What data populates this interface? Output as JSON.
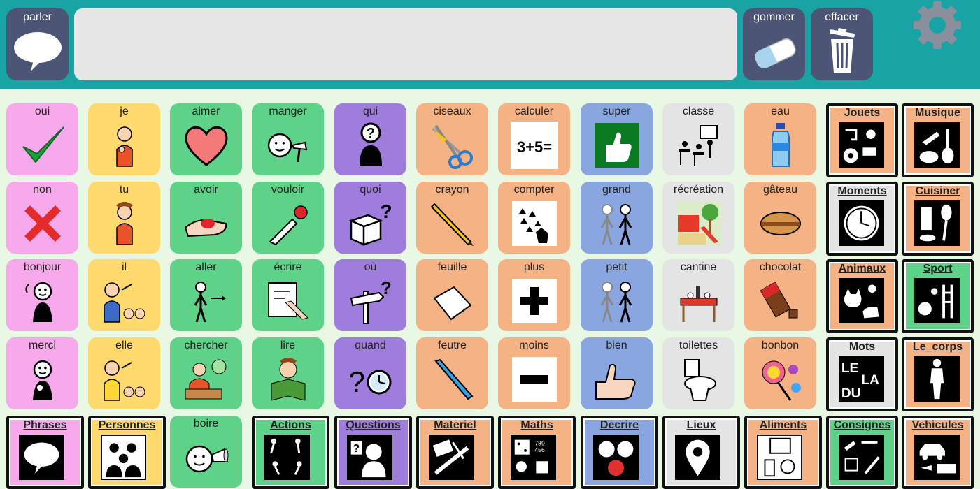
{
  "toolbar": {
    "speak_label": "parler",
    "erase_label": "gommer",
    "clear_label": "effacer",
    "message_text": ""
  },
  "colors": {
    "topbar": "#19a3a5",
    "button": "#4d5576",
    "background": "#e8f8e4",
    "pink": "#f7a9ec",
    "yellow": "#fdd96e",
    "green": "#5fd28a",
    "purple": "#9f7ddd",
    "orange": "#f5b284",
    "blue": "#8aa6e0",
    "gray": "#e4e4e4"
  },
  "grid": {
    "rows": [
      [
        {
          "label": "oui",
          "icon": "checkmark-icon",
          "color": "pink"
        },
        {
          "label": "je",
          "icon": "person-self-icon",
          "color": "yellow"
        },
        {
          "label": "aimer",
          "icon": "heart-icon",
          "color": "green"
        },
        {
          "label": "manger",
          "icon": "eating-icon",
          "color": "green"
        },
        {
          "label": "qui",
          "icon": "who-question-icon",
          "color": "purple"
        },
        {
          "label": "ciseaux",
          "icon": "scissors-icon",
          "color": "orange"
        },
        {
          "label": "calculer",
          "icon": "calculation-icon",
          "color": "orange",
          "pic_text": "3+5="
        },
        {
          "label": "super",
          "icon": "thumbs-up-green-icon",
          "color": "blue"
        },
        {
          "label": "classe",
          "icon": "classroom-icon",
          "color": "gray"
        },
        {
          "label": "eau",
          "icon": "water-bottle-icon",
          "color": "orange"
        },
        {
          "label": "Jouets",
          "icon": "toys-icon",
          "color": "orange",
          "folder": true
        },
        {
          "label": "Musique",
          "icon": "music-instruments-icon",
          "color": "orange",
          "folder": true
        }
      ],
      [
        {
          "label": "non",
          "icon": "cross-icon",
          "color": "pink"
        },
        {
          "label": "tu",
          "icon": "person-you-icon",
          "color": "yellow"
        },
        {
          "label": "avoir",
          "icon": "hand-holding-icon",
          "color": "green"
        },
        {
          "label": "vouloir",
          "icon": "hand-reaching-icon",
          "color": "green"
        },
        {
          "label": "quoi",
          "icon": "box-question-icon",
          "color": "purple"
        },
        {
          "label": "crayon",
          "icon": "pencil-icon",
          "color": "orange"
        },
        {
          "label": "compter",
          "icon": "counting-icon",
          "color": "orange"
        },
        {
          "label": "grand",
          "icon": "tall-person-icon",
          "color": "blue"
        },
        {
          "label": "récréation",
          "icon": "playground-icon",
          "color": "gray"
        },
        {
          "label": "gâteau",
          "icon": "cake-icon",
          "color": "orange"
        },
        {
          "label": "Moments",
          "icon": "clock-icon",
          "color": "gray",
          "folder": true
        },
        {
          "label": "Cuisiner",
          "icon": "kitchen-utensils-icon",
          "color": "orange",
          "folder": true
        }
      ],
      [
        {
          "label": "bonjour",
          "icon": "waving-person-icon",
          "color": "pink"
        },
        {
          "label": "il",
          "icon": "him-icon",
          "color": "yellow"
        },
        {
          "label": "aller",
          "icon": "walking-icon",
          "color": "green"
        },
        {
          "label": "écrire",
          "icon": "writing-icon",
          "color": "green"
        },
        {
          "label": "où",
          "icon": "signpost-question-icon",
          "color": "purple"
        },
        {
          "label": "feuille",
          "icon": "paper-sheet-icon",
          "color": "orange"
        },
        {
          "label": "plus",
          "icon": "plus-icon",
          "color": "orange"
        },
        {
          "label": "petit",
          "icon": "short-person-icon",
          "color": "blue"
        },
        {
          "label": "cantine",
          "icon": "dining-table-icon",
          "color": "gray"
        },
        {
          "label": "chocolat",
          "icon": "chocolate-icon",
          "color": "orange"
        },
        {
          "label": "Animaux",
          "icon": "animals-icon",
          "color": "orange",
          "folder": true
        },
        {
          "label": "Sport",
          "icon": "sports-icon",
          "color": "green",
          "folder": true
        }
      ],
      [
        {
          "label": "merci",
          "icon": "thanking-person-icon",
          "color": "pink"
        },
        {
          "label": "elle",
          "icon": "her-icon",
          "color": "yellow"
        },
        {
          "label": "chercher",
          "icon": "searching-icon",
          "color": "green"
        },
        {
          "label": "lire",
          "icon": "reading-icon",
          "color": "green"
        },
        {
          "label": "quand",
          "icon": "when-clock-icon",
          "color": "purple"
        },
        {
          "label": "feutre",
          "icon": "marker-pen-icon",
          "color": "orange"
        },
        {
          "label": "moins",
          "icon": "minus-icon",
          "color": "orange"
        },
        {
          "label": "bien",
          "icon": "thumbs-up-hand-icon",
          "color": "blue"
        },
        {
          "label": "toilettes",
          "icon": "toilet-icon",
          "color": "gray"
        },
        {
          "label": "bonbon",
          "icon": "candy-icon",
          "color": "orange"
        },
        {
          "label": "Mots",
          "icon": "words-icon",
          "color": "gray",
          "folder": true,
          "pic_text": "LE LA DU"
        },
        {
          "label": "Le_corps",
          "icon": "body-icon",
          "color": "orange",
          "folder": true
        }
      ],
      [
        {
          "label": "Phrases",
          "icon": "speech-bubble-icon",
          "color": "pink",
          "folder": true
        },
        {
          "label": "Personnes",
          "icon": "people-group-icon",
          "color": "yellow",
          "folder": true
        },
        {
          "label": "boire",
          "icon": "drinking-icon",
          "color": "green"
        },
        {
          "label": "Actions",
          "icon": "actions-icon",
          "color": "green",
          "folder": true
        },
        {
          "label": "Questions",
          "icon": "questions-icon",
          "color": "purple",
          "folder": true
        },
        {
          "label": "Materiel",
          "icon": "school-supplies-icon",
          "color": "orange",
          "folder": true
        },
        {
          "label": "Maths",
          "icon": "maths-icon",
          "color": "orange",
          "folder": true
        },
        {
          "label": "Decrire",
          "icon": "describe-faces-icon",
          "color": "blue",
          "folder": true
        },
        {
          "label": "Lieux",
          "icon": "location-pin-icon",
          "color": "gray",
          "folder": true
        },
        {
          "label": "Aliments",
          "icon": "food-icon",
          "color": "orange",
          "folder": true
        },
        {
          "label": "Consignes",
          "icon": "instructions-icon",
          "color": "green",
          "folder": true
        },
        {
          "label": "Vehicules",
          "icon": "vehicles-icon",
          "color": "orange",
          "folder": true
        }
      ]
    ]
  }
}
